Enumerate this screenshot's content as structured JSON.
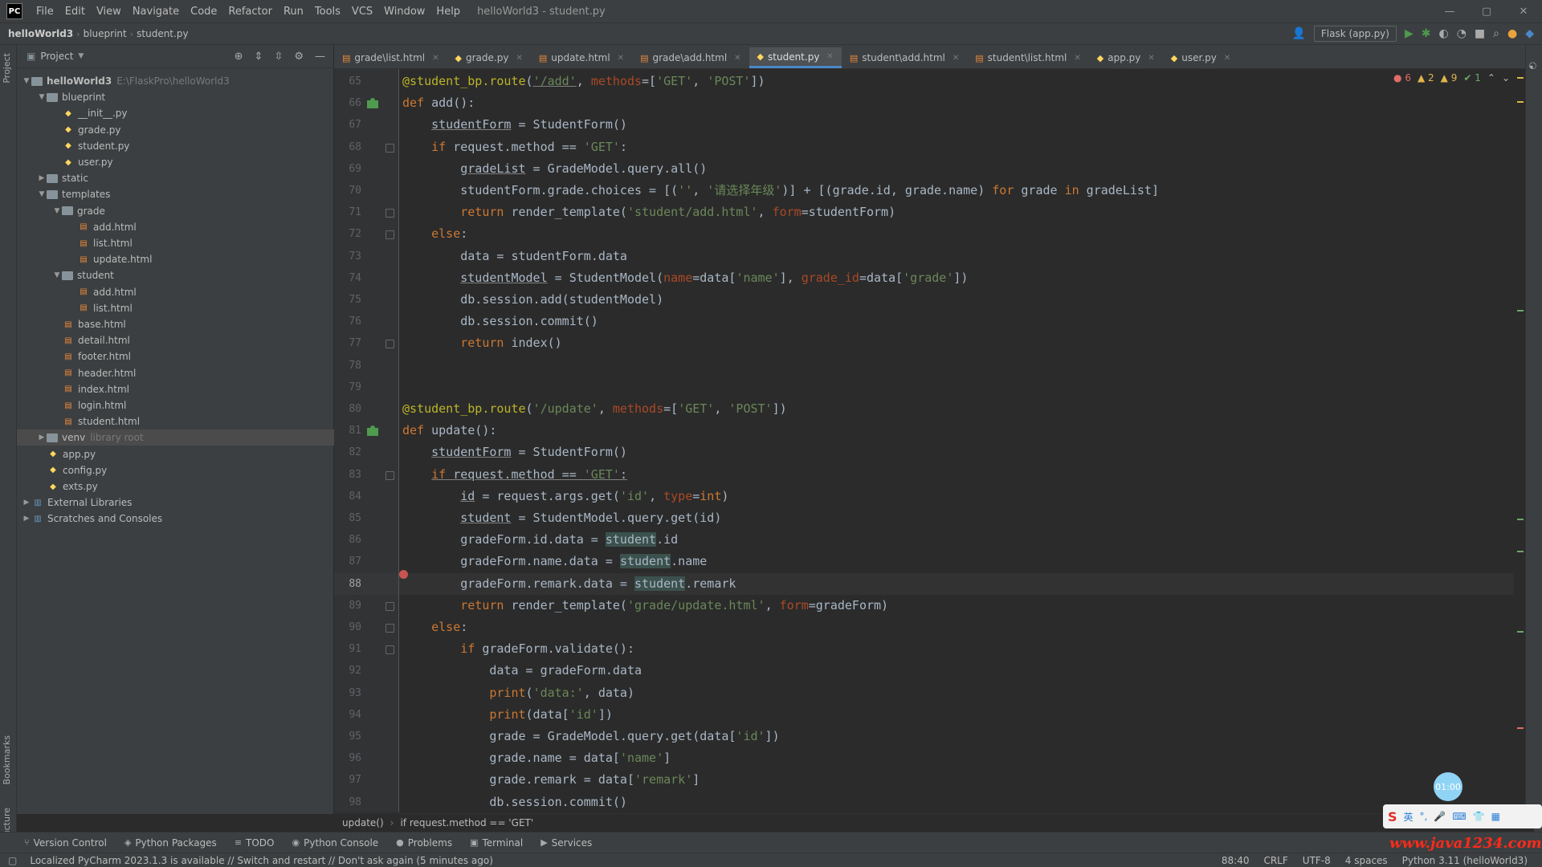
{
  "titlebar": {
    "logo": "PC",
    "menu": [
      "File",
      "Edit",
      "View",
      "Navigate",
      "Code",
      "Refactor",
      "Run",
      "Tools",
      "VCS",
      "Window",
      "Help"
    ],
    "window_title": "helloWorld3 - student.py",
    "controls": [
      "—",
      "▢",
      "✕"
    ]
  },
  "navbar": {
    "project": "helloWorld3",
    "folder": "blueprint",
    "file": "student.py",
    "run_config": "Flask (app.py)"
  },
  "left_strip": {
    "project_label": "Project",
    "bookmarks_label": "Bookmarks",
    "structure_label": "Structure"
  },
  "project_panel": {
    "title": "Project",
    "tree": [
      {
        "depth": 0,
        "arrow": "▼",
        "type": "folder",
        "label": "helloWorld3",
        "hint": "E:\\FlaskPro\\helloWorld3"
      },
      {
        "depth": 1,
        "arrow": "▼",
        "type": "folder",
        "label": "blueprint"
      },
      {
        "depth": 2,
        "arrow": "",
        "type": "py",
        "label": "__init__.py"
      },
      {
        "depth": 2,
        "arrow": "",
        "type": "py",
        "label": "grade.py"
      },
      {
        "depth": 2,
        "arrow": "",
        "type": "py",
        "label": "student.py"
      },
      {
        "depth": 2,
        "arrow": "",
        "type": "py",
        "label": "user.py"
      },
      {
        "depth": 1,
        "arrow": "▶",
        "type": "folder",
        "label": "static"
      },
      {
        "depth": 1,
        "arrow": "▼",
        "type": "folder",
        "label": "templates"
      },
      {
        "depth": 2,
        "arrow": "▼",
        "type": "folder",
        "label": "grade"
      },
      {
        "depth": 3,
        "arrow": "",
        "type": "html",
        "label": "add.html"
      },
      {
        "depth": 3,
        "arrow": "",
        "type": "html",
        "label": "list.html"
      },
      {
        "depth": 3,
        "arrow": "",
        "type": "html",
        "label": "update.html"
      },
      {
        "depth": 2,
        "arrow": "▼",
        "type": "folder",
        "label": "student"
      },
      {
        "depth": 3,
        "arrow": "",
        "type": "html",
        "label": "add.html"
      },
      {
        "depth": 3,
        "arrow": "",
        "type": "html",
        "label": "list.html"
      },
      {
        "depth": 2,
        "arrow": "",
        "type": "html",
        "label": "base.html"
      },
      {
        "depth": 2,
        "arrow": "",
        "type": "html",
        "label": "detail.html"
      },
      {
        "depth": 2,
        "arrow": "",
        "type": "html",
        "label": "footer.html"
      },
      {
        "depth": 2,
        "arrow": "",
        "type": "html",
        "label": "header.html"
      },
      {
        "depth": 2,
        "arrow": "",
        "type": "html",
        "label": "index.html"
      },
      {
        "depth": 2,
        "arrow": "",
        "type": "html",
        "label": "login.html"
      },
      {
        "depth": 2,
        "arrow": "",
        "type": "html",
        "label": "student.html"
      },
      {
        "depth": 1,
        "arrow": "▶",
        "type": "folder",
        "label": "venv",
        "hint": "library root",
        "selected": true
      },
      {
        "depth": 1,
        "arrow": "",
        "type": "py",
        "label": "app.py"
      },
      {
        "depth": 1,
        "arrow": "",
        "type": "py",
        "label": "config.py"
      },
      {
        "depth": 1,
        "arrow": "",
        "type": "py",
        "label": "exts.py"
      },
      {
        "depth": 0,
        "arrow": "▶",
        "type": "lib",
        "label": "External Libraries"
      },
      {
        "depth": 0,
        "arrow": "▶",
        "type": "lib",
        "label": "Scratches and Consoles"
      }
    ]
  },
  "tabs": [
    {
      "label": "grade\\list.html",
      "type": "html"
    },
    {
      "label": "grade.py",
      "type": "py"
    },
    {
      "label": "update.html",
      "type": "html"
    },
    {
      "label": "grade\\add.html",
      "type": "html"
    },
    {
      "label": "student.py",
      "type": "py",
      "active": true
    },
    {
      "label": "student\\add.html",
      "type": "html"
    },
    {
      "label": "student\\list.html",
      "type": "html"
    },
    {
      "label": "app.py",
      "type": "py"
    },
    {
      "label": "user.py",
      "type": "py"
    }
  ],
  "inspections": {
    "errors": "6",
    "warnings": "2",
    "weak_warnings": "9",
    "ok": "1"
  },
  "editor": {
    "current_line": 88,
    "lines": [
      {
        "n": 65,
        "html": "<span class='dec'>@student_bp.route</span>(<span class='str ul'>'/add'</span>, <span class='param'>methods</span>=[<span class='str'>'GET'</span>, <span class='str'>'POST'</span>])"
      },
      {
        "n": 66,
        "html": "<span class='kw'>def</span> add():",
        "gutter": "route"
      },
      {
        "n": 67,
        "html": "    <span class='ul'>studentForm</span> = StudentForm()"
      },
      {
        "n": 68,
        "html": "    <span class='kw'>if</span> request.method == <span class='str'>'GET'</span>:",
        "fold": true
      },
      {
        "n": 69,
        "html": "        <span class='ul'>gradeList</span> = GradeModel.query.all()"
      },
      {
        "n": 70,
        "html": "        studentForm.grade.choices = [(<span class='str'>''</span>, <span class='str'>'请选择年级'</span>)] + [(grade.id, grade.name) <span class='kw'>for</span> grade <span class='kw'>in</span> gradeList]"
      },
      {
        "n": 71,
        "html": "        <span class='kw'>return</span> render_template(<span class='str'>'student/add.html'</span>, <span class='param'>form</span>=studentForm)",
        "fold": true
      },
      {
        "n": 72,
        "html": "    <span class='kw'>else</span>:",
        "fold": true
      },
      {
        "n": 73,
        "html": "        data = studentForm.data"
      },
      {
        "n": 74,
        "html": "        <span class='ul'>studentModel</span> = StudentModel(<span class='param'>name</span>=data[<span class='str'>'name'</span>], <span class='param'>grade_id</span>=data[<span class='str'>'grade'</span>])"
      },
      {
        "n": 75,
        "html": "        db.session.add(studentModel)"
      },
      {
        "n": 76,
        "html": "        db.session.commit()"
      },
      {
        "n": 77,
        "html": "        <span class='kw'>return</span> index()",
        "fold": true
      },
      {
        "n": 78,
        "html": ""
      },
      {
        "n": 79,
        "html": ""
      },
      {
        "n": 80,
        "html": "<span class='dec'>@student_bp.route</span>(<span class='str'>'/update'</span>, <span class='param'>methods</span>=[<span class='str'>'GET'</span>, <span class='str'>'POST'</span>])"
      },
      {
        "n": 81,
        "html": "<span class='kw'>def</span> update():",
        "gutter": "route"
      },
      {
        "n": 82,
        "html": "    <span class='ul'>studentForm</span> = StudentForm()"
      },
      {
        "n": 83,
        "html": "    <span class='kw ul'>if</span><span class='ul'> request.method == </span><span class='str ul'>'GET'</span><span class='ul'>:</span>",
        "fold": true
      },
      {
        "n": 84,
        "html": "        <span class='ul'>id</span> = request.args.get(<span class='str'>'id'</span>, <span class='param'>type</span>=<span class='kw'>int</span>)"
      },
      {
        "n": 85,
        "html": "        <span class='ul'>student</span> = StudentModel.query.get(id)"
      },
      {
        "n": 86,
        "html": "        gradeForm.id.data = <span class='hl'>student</span>.id"
      },
      {
        "n": 87,
        "html": "        gradeForm.name.data = <span class='hl'>student</span>.name"
      },
      {
        "n": 88,
        "html": "        gradeForm.remark.data = <span class='hl'>student</span>.remark",
        "breakpoint": true
      },
      {
        "n": 89,
        "html": "        <span class='kw'>return</span> render_template(<span class='str'>'grade/update.html'</span>, <span class='param'>form</span>=gradeForm)",
        "fold": true
      },
      {
        "n": 90,
        "html": "    <span class='kw'>else</span>:",
        "fold": true
      },
      {
        "n": 91,
        "html": "        <span class='kw'>if</span> gradeForm.validate():",
        "fold": true
      },
      {
        "n": 92,
        "html": "            data = gradeForm.data"
      },
      {
        "n": 93,
        "html": "            <span class='kw'>print</span>(<span class='str'>'data:'</span>, data)"
      },
      {
        "n": 94,
        "html": "            <span class='kw'>print</span>(data[<span class='str'>'id'</span>])"
      },
      {
        "n": 95,
        "html": "            grade = GradeModel.query.get(data[<span class='str'>'id'</span>])"
      },
      {
        "n": 96,
        "html": "            grade.name = data[<span class='str'>'name'</span>]"
      },
      {
        "n": 97,
        "html": "            grade.remark = data[<span class='str'>'remark'</span>]"
      },
      {
        "n": 98,
        "html": "            db.session.commit()"
      }
    ]
  },
  "code_breadcrumb": [
    "update()",
    "if request.method == 'GET'"
  ],
  "tool_tabs": [
    {
      "icon": "⑂",
      "label": "Version Control"
    },
    {
      "icon": "◈",
      "label": "Python Packages"
    },
    {
      "icon": "≡",
      "label": "TODO"
    },
    {
      "icon": "◉",
      "label": "Python Console"
    },
    {
      "icon": "●",
      "label": "Problems"
    },
    {
      "icon": "▣",
      "label": "Terminal"
    },
    {
      "icon": "▶",
      "label": "Services"
    }
  ],
  "status": {
    "message": "Localized PyCharm 2023.1.3 is available // Switch and restart // Don't ask again (5 minutes ago)",
    "position": "88:40",
    "line_sep": "CRLF",
    "encoding": "UTF-8",
    "indent": "4 spaces",
    "interpreter": "Python 3.11 (helloWorld3)"
  },
  "overlay": {
    "bubble": "01:00",
    "ime": "S",
    "ime_label": "英",
    "watermark": "www.java1234.com"
  }
}
